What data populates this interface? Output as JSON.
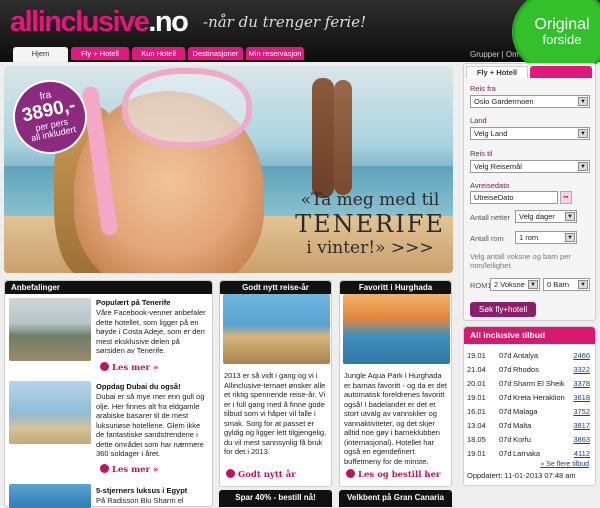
{
  "header": {
    "logo_main": "allinclusive",
    "logo_tld": ".no",
    "slogan": "-når du trenger ferie!",
    "badge_line1": "Original",
    "badge_line2": "forside",
    "top_links": "Grupper | Om",
    "accent": "#e0197f",
    "badge_color": "#32c12a"
  },
  "tabs": [
    "Hjem",
    "Fly + Hotell",
    "Kun Hotell",
    "Destinasjoner",
    "Min reservasjon"
  ],
  "hero": {
    "price_pre": "fra",
    "price": "3890,-",
    "price_post": "per pers",
    "price_post2": "all inkludert",
    "line1": "«Ta meg med til",
    "line2": "TENERIFE",
    "line3": "i vinter!» >>>"
  },
  "booking": {
    "tab_active": "Fly + Hotell",
    "from_label": "Reis fra",
    "from_value": "Oslo Gardermoen",
    "country_label": "Land",
    "country_value": "Velg Land",
    "to_label": "Reis til",
    "to_value": "Velg Reisemål",
    "date_label": "Avreisedato",
    "date_value": "UtreiseDato",
    "nights_label": "Antall netter",
    "nights_value": "Velg dager",
    "rooms_label": "Antall rom",
    "rooms_value": "1 rom",
    "persons_label": "Velg antall voksne og barn per rom/leilighet",
    "room_label": "ROM1",
    "adults_value": "2 Voksne",
    "children_value": "0 Barn",
    "search_button": "Søk fly+hotell"
  },
  "deals": {
    "title": "All inclusive tilbud",
    "rows": [
      {
        "date": "19.01",
        "nights": "07d",
        "dest": "Antalya",
        "price": "2466"
      },
      {
        "date": "21.04",
        "nights": "07d",
        "dest": "Rhodos",
        "price": "3322"
      },
      {
        "date": "20.01",
        "nights": "07d",
        "dest": "Sharm El Sheik",
        "price": "3378"
      },
      {
        "date": "19.01",
        "nights": "07d",
        "dest": "Kreta Heraklion",
        "price": "3618"
      },
      {
        "date": "16.01",
        "nights": "07d",
        "dest": "Malaga",
        "price": "3752"
      },
      {
        "date": "13.04",
        "nights": "07d",
        "dest": "Malta",
        "price": "3817"
      },
      {
        "date": "18.05",
        "nights": "07d",
        "dest": "Korfu",
        "price": "3863"
      },
      {
        "date": "19.01",
        "nights": "07d",
        "dest": "Larnaka",
        "price": "4112"
      }
    ],
    "more_link": "» Se flere tilbud",
    "updated": "Oppdatert: 11-01-2013 07:48 am"
  },
  "recommendations": {
    "title": "Anbefalinger",
    "items": [
      {
        "title": "Populært på Tenerife",
        "body": "Våre Facebook-venner anbefaler dette hotellet, som ligger på en høyde i Costa Adeje, som er den mest eksklusive delen på sørsiden av Tenerife.",
        "more": "Les mer »"
      },
      {
        "title": "Oppdag Dubai du også!",
        "body": "Dubai er så mye mer enn gull og olje. Her finnes alt fra eldgamle arabiske basarer til de mest luksuriøse hotellene. Glem ikke de fantastiske sandstrendene i dette området som har nærmere 360 soldager i året.",
        "more": "Les mer »"
      },
      {
        "title": "5-stjerners luksus i Egypt",
        "body": "På Radisson Blu Sharm el"
      }
    ]
  },
  "news": {
    "title": "Godt nytt reise-år",
    "body": "2013 er så vidt i gang og vi i Allinclusive-temaet ønsker alle et riktig spennende reise-år. Vi er i full gang med å finne gode tilbud som vi håper vil falle i smak. Sorg for at passet er gyldig og ligger lett tilgjengelig, du vil mest sannsynlig få bruk for det i 2013.",
    "more": "Godt nytt år"
  },
  "favorite": {
    "title": "Favoritt i Hurghada",
    "body": "Jungle Aqua Park i Hurghada er barnas favoritt - og da er det automatisk foreldrenes favoritt også! I badelandet er det et stort utvalg av vannsklier og vannaktiviteter, og det skjer alltid noe gøy i barneklubben (internasjonal). Hotellet har også en egendefinert buffetmeny for de minste.",
    "more": "Les og bestill her"
  },
  "bottom": {
    "box1": "Spar 40% - bestill nå!",
    "box2": "Velkbent på Gran Canaria"
  }
}
